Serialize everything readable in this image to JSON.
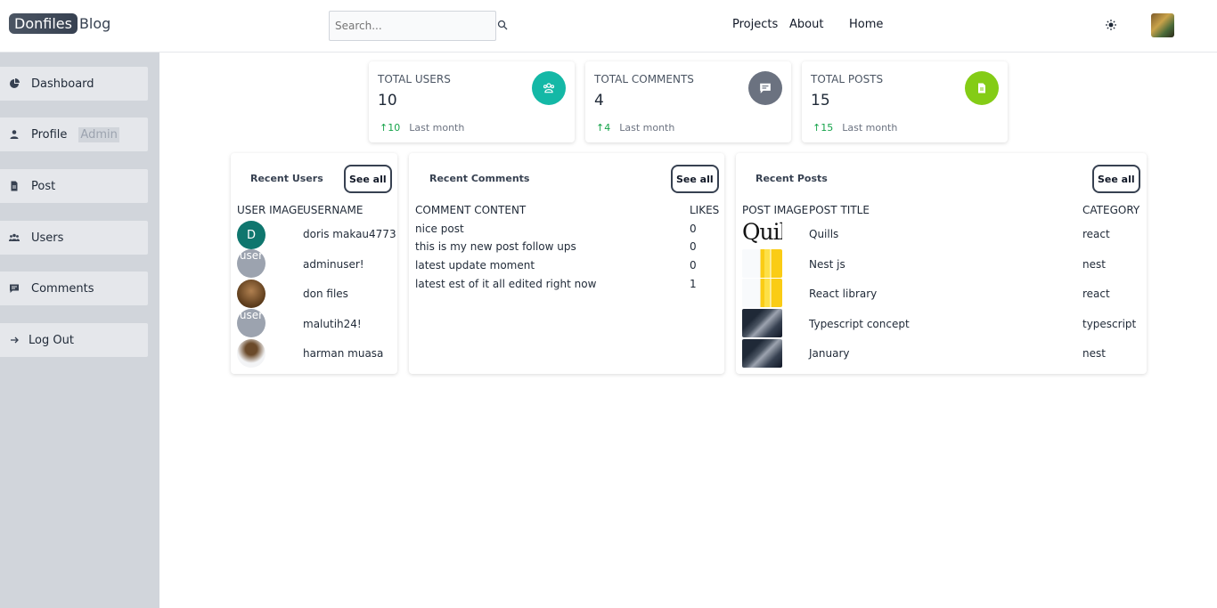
{
  "header": {
    "logo_box": "Donfiles",
    "logo_text": "Blog",
    "search_placeholder": "Search...",
    "nav": [
      "Projects",
      "About",
      "Home"
    ]
  },
  "sidebar": {
    "items": [
      {
        "label": "Dashboard",
        "icon": "pie-chart-icon"
      },
      {
        "label": "Profile",
        "icon": "user-icon",
        "badge": "Admin"
      },
      {
        "label": "Post",
        "icon": "document-icon"
      },
      {
        "label": "Users",
        "icon": "users-icon"
      },
      {
        "label": "Comments",
        "icon": "comment-icon"
      },
      {
        "label": "Log Out",
        "icon": "arrow-right-icon"
      }
    ]
  },
  "stats": [
    {
      "title": "TOTAL USERS",
      "value": "10",
      "delta": "10",
      "period": "Last month",
      "color": "#14b8a6",
      "icon": "users-icon"
    },
    {
      "title": "TOTAL COMMENTS",
      "value": "4",
      "delta": "4",
      "period": "Last month",
      "color": "#6b7280",
      "icon": "comment-icon"
    },
    {
      "title": "TOTAL POSTS",
      "value": "15",
      "delta": "15",
      "period": "Last month",
      "color": "#84cc16",
      "icon": "document-icon"
    }
  ],
  "recent_users": {
    "title": "Recent Users",
    "see_all": "See all",
    "headers": [
      "USER IMAGE",
      "USERNAME"
    ],
    "rows": [
      {
        "avatar": "D",
        "username": "doris makau4773"
      },
      {
        "avatar": "user",
        "username": "adminuser!"
      },
      {
        "avatar": "",
        "username": "don files"
      },
      {
        "avatar": "user",
        "username": "malutih24!"
      },
      {
        "avatar": "",
        "username": "harman muasa"
      }
    ]
  },
  "recent_comments": {
    "title": "Recent Comments",
    "see_all": "See all",
    "headers": [
      "COMMENT CONTENT",
      "LIKES"
    ],
    "rows": [
      {
        "content": "nice post",
        "likes": "0"
      },
      {
        "content": "this is my new post follow ups",
        "likes": "0"
      },
      {
        "content": "latest update moment",
        "likes": "0"
      },
      {
        "content": "latest est of it all edited right now",
        "likes": "1"
      }
    ]
  },
  "recent_posts": {
    "title": "Recent Posts",
    "see_all": "See all",
    "headers": [
      "POST IMAGE",
      "POST TITLE",
      "CATEGORY"
    ],
    "rows": [
      {
        "image_text": "Quill",
        "title": "Quills",
        "category": "react"
      },
      {
        "image_text": "",
        "title": "Nest js",
        "category": "nest"
      },
      {
        "image_text": "",
        "title": "React library",
        "category": "react"
      },
      {
        "image_text": "",
        "title": "Typescript concept",
        "category": "typescript"
      },
      {
        "image_text": "",
        "title": "January",
        "category": "nest"
      }
    ]
  }
}
